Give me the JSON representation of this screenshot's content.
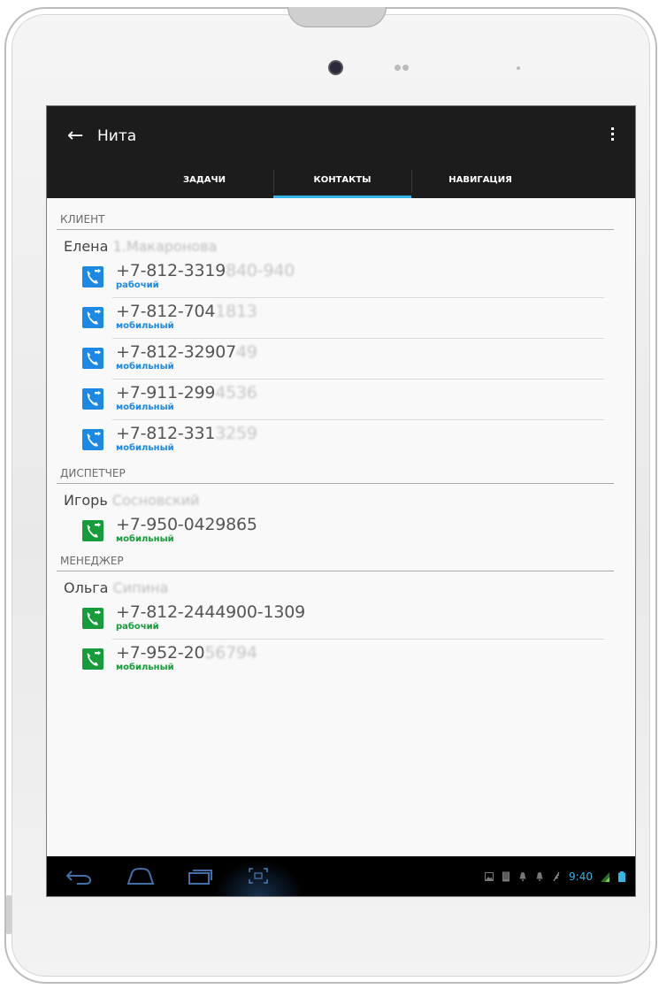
{
  "header": {
    "back_icon": "back-arrow-icon",
    "title": "Нита",
    "overflow_icon": "overflow-menu-icon"
  },
  "tabs": [
    {
      "label": "ЗАДАЧИ",
      "selected": false
    },
    {
      "label": "КОНТАКТЫ",
      "selected": true
    },
    {
      "label": "НАВИГАЦИЯ",
      "selected": false
    }
  ],
  "colors": {
    "client_accent": "#1e88e5",
    "green_accent": "#169c3a",
    "tab_indicator": "#33b5e5"
  },
  "sections": [
    {
      "role": "КЛИЕНТ",
      "first_name": "Елена",
      "last_name_blurred": "1.Макаронова",
      "phones": [
        {
          "number": "+7-812-3319",
          "blurred": "840-940",
          "type": "рабочий"
        },
        {
          "number": "+7-812-704",
          "blurred": "1813",
          "type": "мобильный"
        },
        {
          "number": "+7-812-32907",
          "blurred": "49",
          "type": "мобильный"
        },
        {
          "number": "+7-911-299",
          "blurred": "4536",
          "type": "мобильный"
        },
        {
          "number": "+7-812-331",
          "blurred": "3259",
          "type": "мобильный"
        }
      ]
    },
    {
      "role": "ДИСПЕТЧЕР",
      "first_name": "Игорь",
      "last_name_blurred": "Сосновский",
      "phones": [
        {
          "number": "+7-950-0429865",
          "blurred": "",
          "type": "мобильный"
        }
      ]
    },
    {
      "role": "МЕНЕДЖЕР",
      "first_name": "Ольга",
      "last_name_blurred": "Сипина",
      "phones": [
        {
          "number": "+7-812-2444900-1309",
          "blurred": "",
          "type": "рабочий"
        },
        {
          "number": "+7-952-20",
          "blurred": "56794",
          "type": "мобильный"
        }
      ]
    }
  ],
  "navbar": {
    "back_icon": "nav-back-icon",
    "home_icon": "nav-home-icon",
    "recents_icon": "nav-recents-icon",
    "screenshot_icon": "screenshot-icon"
  },
  "status": {
    "time": "9:40",
    "icons": [
      "gallery-icon",
      "sd-card-icon",
      "notification-icon",
      "notification-icon",
      "usb-debug-icon",
      "signal-icon",
      "battery-icon"
    ]
  }
}
